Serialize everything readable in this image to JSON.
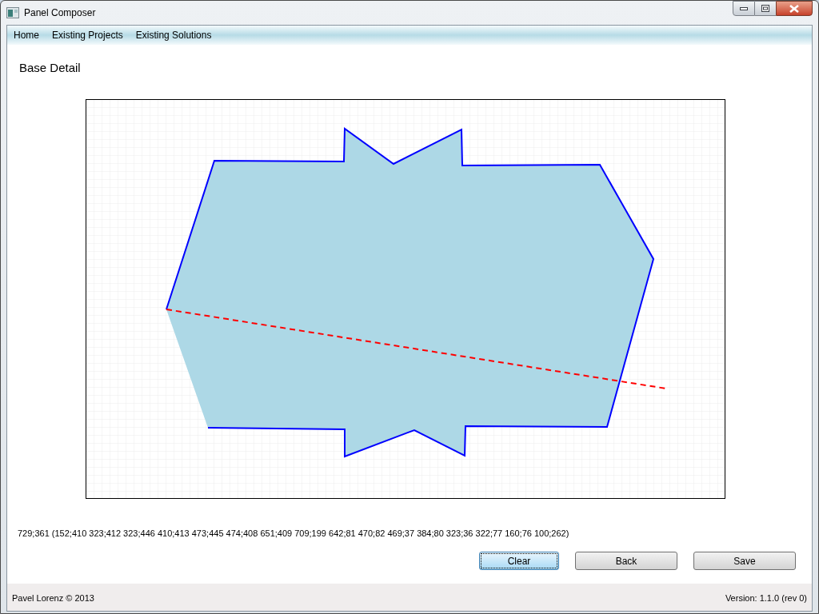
{
  "window": {
    "title": "Panel Composer"
  },
  "menu": [
    {
      "label": "Home"
    },
    {
      "label": "Existing Projects"
    },
    {
      "label": "Existing Solutions"
    }
  ],
  "page_title": "Base Detail",
  "coordinates": "729;361 (152;410 323;412 323;446 410;413 473;445 474;408 651;409 709;199 642;81 470;82 469;37 384;80 323;36 322;77 160;76 100;262)",
  "buttons": [
    {
      "label": "Clear",
      "focused": true
    },
    {
      "label": "Back",
      "focused": false
    },
    {
      "label": "Save",
      "focused": false
    }
  ],
  "status_bar": {
    "left": "Pavel Lorenz © 2013",
    "right": "Version: 1.1.0 (rev 0)"
  }
}
